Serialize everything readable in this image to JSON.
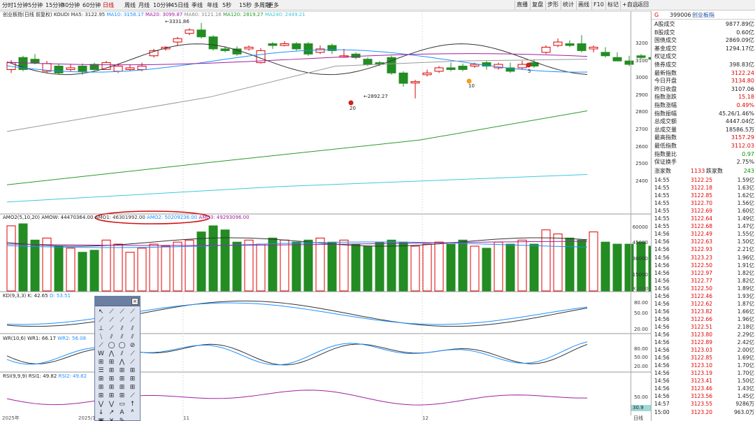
{
  "toolbar": {
    "periods": [
      "分时",
      "1分钟",
      "5分钟",
      "15分钟",
      "30分钟",
      "60分钟",
      "日线",
      "周线",
      "月线",
      "10分钟",
      "45日线",
      "季线",
      "年线",
      "5秒",
      "15秒",
      "多周期",
      "更多"
    ],
    "active": "日线",
    "right_buttons": [
      "直播",
      "复盘",
      "步形",
      "统计",
      "画线",
      "F10",
      "标记",
      "+自选",
      "返回"
    ]
  },
  "price_pane": {
    "title": "创业板指(日线 前复权)",
    "indicator": "KOUDI",
    "ma5": "MA5: 3122.95",
    "ma10": "MA10: 3158.17",
    "ma20": "MA20: 3099.87",
    "ma60": "MA60: 3121.16",
    "ma120": "MA120: 2819.27",
    "ma240": "MA240: 2449.21",
    "high_note": "3331.86",
    "low_note": "2892.27",
    "signals": [
      "20",
      "10",
      "5"
    ],
    "ticks": [
      "3200",
      "3100",
      "3000",
      "2900",
      "2800",
      "2700",
      "2600",
      "2500",
      "2400"
    ]
  },
  "amo_pane": {
    "title": "AMO2(5,10,20)",
    "amow": "AMOW: 44470364.00",
    "amo1": "AMO1: 46301992.00",
    "amo2": "AMO2: 50209236.00",
    "amo3": "AMO3: 49293096.00",
    "ticks": [
      "60000",
      "45000",
      "30000",
      "15000"
    ],
    "unit": "X1000"
  },
  "kd_pane": {
    "title": "KD(9,3,3)",
    "k": "K: 42.65",
    "d": "D: 53.51",
    "ticks": [
      "80.00",
      "50.00",
      "20.00"
    ]
  },
  "wr_pane": {
    "title": "WR(10,6)",
    "wr1": "WR1: 66.17",
    "wr2": "WR2: 56.08",
    "ticks": [
      "80.00",
      "50.00",
      "20.00"
    ]
  },
  "rsi_pane": {
    "title": "RSI(9,9,9)",
    "rsi1": "RSI1: 49.82",
    "rsi2": "RSI2: 49.82",
    "ticks": [
      "50.00"
    ],
    "marker": "30.9"
  },
  "time_axis": {
    "labels": [
      "2025年",
      "2025/11",
      "11",
      "12"
    ],
    "period_label": "日线"
  },
  "side_panel": {
    "code": "399006",
    "name": "创业板指",
    "badge": "G",
    "stats": [
      {
        "k": "A股成交",
        "v": "9877.89亿",
        "c": ""
      },
      {
        "k": "B股成交",
        "v": "0.60亿",
        "c": ""
      },
      {
        "k": "国债成交",
        "v": "2869.09亿",
        "c": ""
      },
      {
        "k": "基金成交",
        "v": "1294.17亿",
        "c": ""
      },
      {
        "k": "权证成交",
        "v": "",
        "c": ""
      },
      {
        "k": "债券成交",
        "v": "398.83亿",
        "c": ""
      },
      {
        "k": "最新指数",
        "v": "3122.24",
        "c": "red"
      },
      {
        "k": "今日开盘",
        "v": "3134.80",
        "c": "red"
      },
      {
        "k": "昨日收盘",
        "v": "3107.06",
        "c": ""
      },
      {
        "k": "指数涨跌",
        "v": "15.18",
        "c": "red"
      },
      {
        "k": "指数涨幅",
        "v": "0.49%",
        "c": "red"
      },
      {
        "k": "指数振幅",
        "v": "45.26/1.46%",
        "c": ""
      },
      {
        "k": "总成交额",
        "v": "4447.04亿",
        "c": ""
      },
      {
        "k": "总成交量",
        "v": "18586.5万",
        "c": ""
      },
      {
        "k": "最高指数",
        "v": "3157.29",
        "c": "red"
      },
      {
        "k": "最低指数",
        "v": "3112.03",
        "c": "red"
      },
      {
        "k": "指数量比",
        "v": "0.97",
        "c": "grn"
      },
      {
        "k": "保证换手",
        "v": "2.75%",
        "c": ""
      }
    ],
    "up_label": "涨家数",
    "up": "1133",
    "down_label": "跌家数",
    "down": "243",
    "ticks": [
      [
        "14:55",
        "3122.25",
        "1.59亿"
      ],
      [
        "14:55",
        "3122.18",
        "1.63亿"
      ],
      [
        "14:55",
        "3122.85",
        "1.62亿"
      ],
      [
        "14:55",
        "3122.70",
        "1.56亿"
      ],
      [
        "14:55",
        "3122.69",
        "1.60亿"
      ],
      [
        "14:55",
        "3122.64",
        "1.49亿"
      ],
      [
        "14:55",
        "3122.68",
        "1.47亿"
      ],
      [
        "14:56",
        "3122.49",
        "1.55亿"
      ],
      [
        "14:56",
        "3122.63",
        "1.50亿"
      ],
      [
        "14:56",
        "3122.93",
        "2.21亿"
      ],
      [
        "14:56",
        "3123.23",
        "1.96亿"
      ],
      [
        "14:56",
        "3122.50",
        "1.91亿"
      ],
      [
        "14:56",
        "3122.97",
        "1.82亿"
      ],
      [
        "14:56",
        "3122.77",
        "1.82亿"
      ],
      [
        "14:56",
        "3122.50",
        "1.89亿"
      ],
      [
        "14:56",
        "3122.46",
        "1.93亿"
      ],
      [
        "14:56",
        "3122.62",
        "1.87亿"
      ],
      [
        "14:56",
        "3123.82",
        "1.66亿"
      ],
      [
        "14:56",
        "3122.66",
        "1.96亿"
      ],
      [
        "14:56",
        "3122.51",
        "2.18亿"
      ],
      [
        "14:56",
        "3123.80",
        "2.29亿"
      ],
      [
        "14:56",
        "3122.89",
        "2.42亿"
      ],
      [
        "14:56",
        "3123.03",
        "2.00亿"
      ],
      [
        "14:56",
        "3122.85",
        "1.69亿"
      ],
      [
        "14:56",
        "3123.10",
        "1.70亿"
      ],
      [
        "14:56",
        "3123.19",
        "1.70亿"
      ],
      [
        "14:56",
        "3123.41",
        "1.50亿"
      ],
      [
        "14:56",
        "3123.46",
        "1.43亿"
      ],
      [
        "14:56",
        "3123.56",
        "1.45亿"
      ],
      [
        "14:57",
        "3123.55",
        "9286万"
      ],
      [
        "15:00",
        "3123.20",
        "963.0万"
      ]
    ]
  },
  "colors": {
    "up": "#e00000",
    "down": "#238c23",
    "ma5": "#333333",
    "ma10": "#1e90ff",
    "ma20": "#a020a0",
    "ma60": "#999999",
    "ma120": "#2a9a2a",
    "ma240": "#40c8d8"
  }
}
